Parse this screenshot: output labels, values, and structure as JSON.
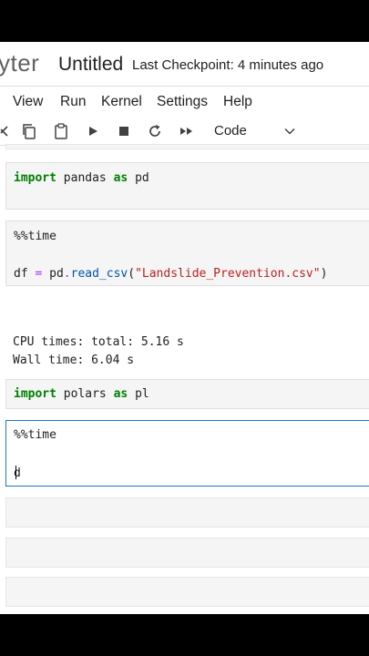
{
  "header": {
    "logo_text": "yter",
    "notebook_title": "Untitled",
    "checkpoint": "Last Checkpoint: 4 minutes ago"
  },
  "menu": {
    "items": [
      {
        "label": "View"
      },
      {
        "label": "Run"
      },
      {
        "label": "Kernel"
      },
      {
        "label": "Settings"
      },
      {
        "label": "Help"
      }
    ]
  },
  "toolbar": {
    "cell_type": "Code"
  },
  "cells": [
    {
      "kw1": "import",
      "mid": " pandas ",
      "kw2": "as",
      "end": " pd"
    },
    {
      "line1": "%%time",
      "line3_a": "df ",
      "line3_op1": "=",
      "line3_b": " pd",
      "line3_op2": ".",
      "line3_fn": "read_csv",
      "line3_c": "(",
      "line3_str": "\"Landslide_Prevention.csv\"",
      "line3_d": ")",
      "output1": "CPU times: total: 5.16 s",
      "output2": "Wall time: 6.04 s"
    },
    {
      "kw1": "import",
      "mid": " polars ",
      "kw2": "as",
      "end": " pl"
    },
    {
      "line1": "%%time",
      "line3": "d"
    }
  ]
}
